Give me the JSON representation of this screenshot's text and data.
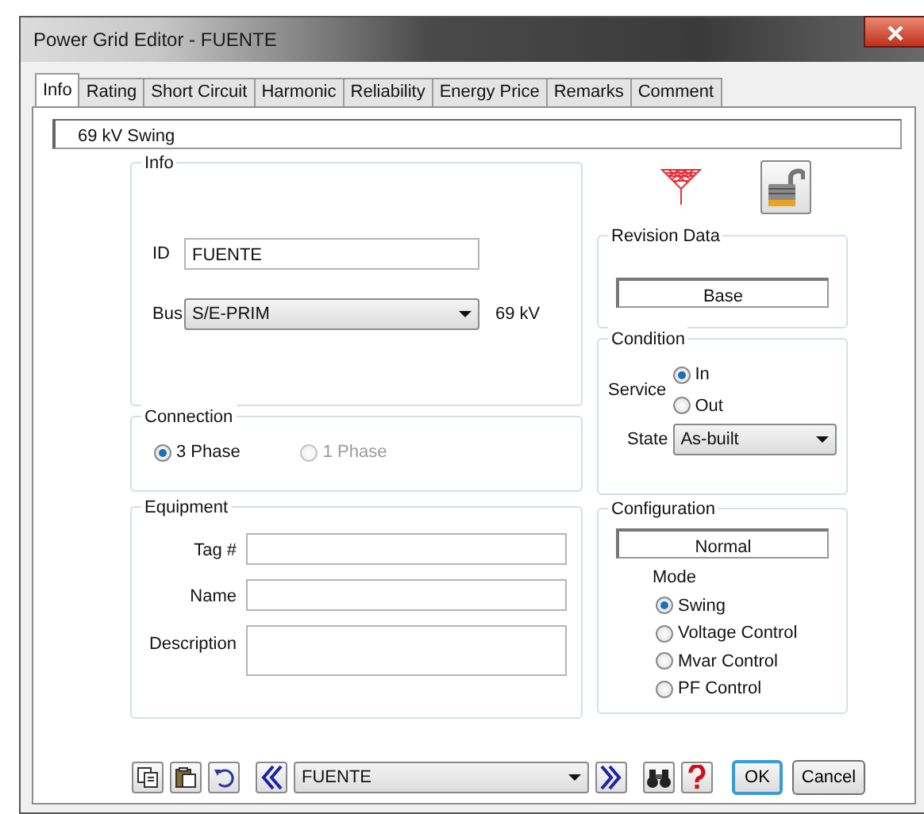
{
  "window": {
    "title": "Power Grid Editor - FUENTE"
  },
  "tabs": [
    {
      "label": "Info",
      "selected": true
    },
    {
      "label": "Rating",
      "selected": false
    },
    {
      "label": "Short Circuit",
      "selected": false
    },
    {
      "label": "Harmonic",
      "selected": false
    },
    {
      "label": "Reliability",
      "selected": false
    },
    {
      "label": "Energy Price",
      "selected": false
    },
    {
      "label": "Remarks",
      "selected": false
    },
    {
      "label": "Comment",
      "selected": false
    }
  ],
  "status_field": {
    "value": "69 kV  Swing"
  },
  "info_group": {
    "title": "Info",
    "id": {
      "label": "ID",
      "value": "FUENTE"
    },
    "bus": {
      "label": "Bus",
      "value": "S/E-PRIM",
      "voltage": "69 kV"
    }
  },
  "connection_group": {
    "title": "Connection",
    "options": [
      {
        "label": "3 Phase",
        "selected": true,
        "disabled": false
      },
      {
        "label": "1 Phase",
        "selected": false,
        "disabled": true
      }
    ]
  },
  "equipment_group": {
    "title": "Equipment",
    "fields": [
      {
        "label": "Tag #",
        "kind": "line"
      },
      {
        "label": "Name",
        "kind": "line"
      },
      {
        "label": "Description",
        "kind": "area"
      }
    ]
  },
  "lock": {
    "locked": false
  },
  "revision_group": {
    "title": "Revision Data",
    "value": "Base"
  },
  "condition_group": {
    "title": "Condition",
    "service": {
      "label": "Service",
      "options": [
        {
          "label": "In",
          "selected": true
        },
        {
          "label": "Out",
          "selected": false
        }
      ]
    },
    "state": {
      "label": "State",
      "value": "As-built"
    }
  },
  "configuration_group": {
    "title": "Configuration",
    "value": "Normal",
    "mode": {
      "label": "Mode",
      "options": [
        {
          "label": "Swing",
          "selected": true
        },
        {
          "label": "Voltage Control",
          "selected": false
        },
        {
          "label": "Mvar Control",
          "selected": false
        },
        {
          "label": "PF Control",
          "selected": false
        }
      ]
    }
  },
  "toolbar": {
    "record": "FUENTE",
    "buttons": [
      {
        "label": "OK",
        "default": true
      },
      {
        "label": "Cancel",
        "default": false
      }
    ]
  }
}
